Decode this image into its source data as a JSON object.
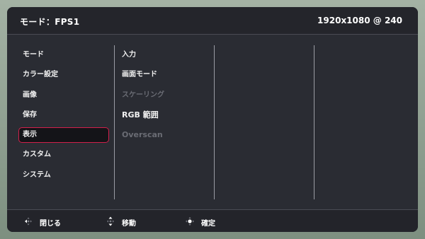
{
  "header": {
    "mode_label": "モード：FPS1",
    "resolution": "1920x1080 @ 240"
  },
  "main_menu": [
    {
      "label": "モード",
      "selected": false
    },
    {
      "label": "カラー設定",
      "selected": false
    },
    {
      "label": "画像",
      "selected": false
    },
    {
      "label": "保存",
      "selected": false
    },
    {
      "label": "表示",
      "selected": true
    },
    {
      "label": "カスタム",
      "selected": false
    },
    {
      "label": "システム",
      "selected": false
    }
  ],
  "sub_menu": [
    {
      "label": "入力",
      "enabled": true
    },
    {
      "label": "画面モード",
      "enabled": true
    },
    {
      "label": "スケーリング",
      "enabled": false
    },
    {
      "label": "RGB 範囲",
      "enabled": true
    },
    {
      "label": "Overscan",
      "enabled": false
    }
  ],
  "footer": {
    "close": {
      "label": "閉じる",
      "icon": "dpad-left-icon"
    },
    "move": {
      "label": "移動",
      "icon": "dpad-updown-icon"
    },
    "confirm": {
      "label": "確定",
      "icon": "dpad-center-icon"
    }
  },
  "colors": {
    "osd_background": "#2a2c33",
    "selection_border": "#d21f4b",
    "text": "#ffffff",
    "disabled_text": "#6a6c74"
  }
}
